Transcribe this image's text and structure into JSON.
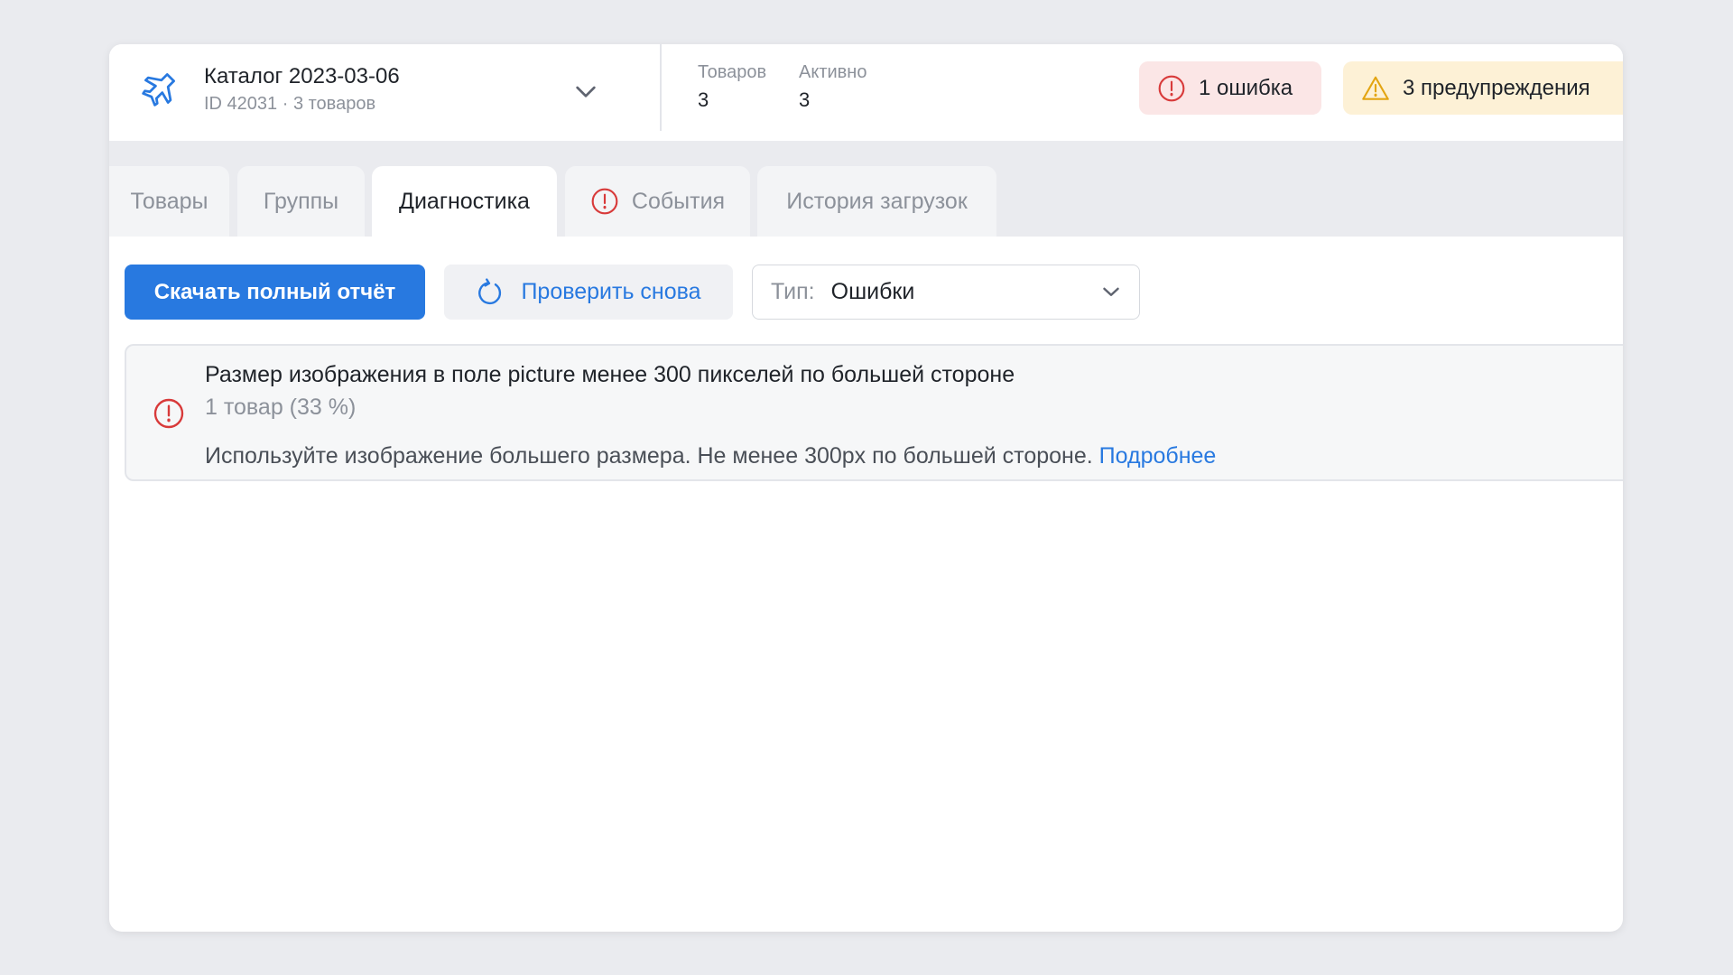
{
  "header": {
    "catalog_title": "Каталог 2023-03-06",
    "catalog_subtitle": "ID 42031 · 3 товаров",
    "stats": [
      {
        "label": "Товаров",
        "value": "3"
      },
      {
        "label": "Активно",
        "value": "3"
      }
    ],
    "error_badge": "1 ошибка",
    "warning_badge": "3 предупреждения"
  },
  "tabs": [
    {
      "label": "Товары"
    },
    {
      "label": "Группы"
    },
    {
      "label": "Диагностика"
    },
    {
      "label": "События"
    },
    {
      "label": "История загрузок"
    }
  ],
  "active_tab": "Диагностика",
  "toolbar": {
    "download_label": "Скачать полный отчёт",
    "recheck_label": "Проверить снова",
    "type_label": "Тип:",
    "type_value": "Ошибки"
  },
  "diagnostics": [
    {
      "title": "Размер изображения в поле picture менее 300 пикселей по большей стороне",
      "count": "1 товар (33 %)",
      "advice": "Используйте изображение большего размера. Не менее 300px по большей стороне.",
      "link": "Подробнее"
    }
  ],
  "colors": {
    "accent": "#2879e0",
    "error": "#d83a3a",
    "warning": "#e3a512",
    "error_bg": "#fbe6e6",
    "warning_bg": "#fdf1d6"
  },
  "icons": {
    "catalog": "airplane-icon",
    "dropdown": "chevron-down-icon",
    "error": "error-circle-icon",
    "warning": "warning-triangle-icon",
    "refresh": "refresh-icon"
  }
}
